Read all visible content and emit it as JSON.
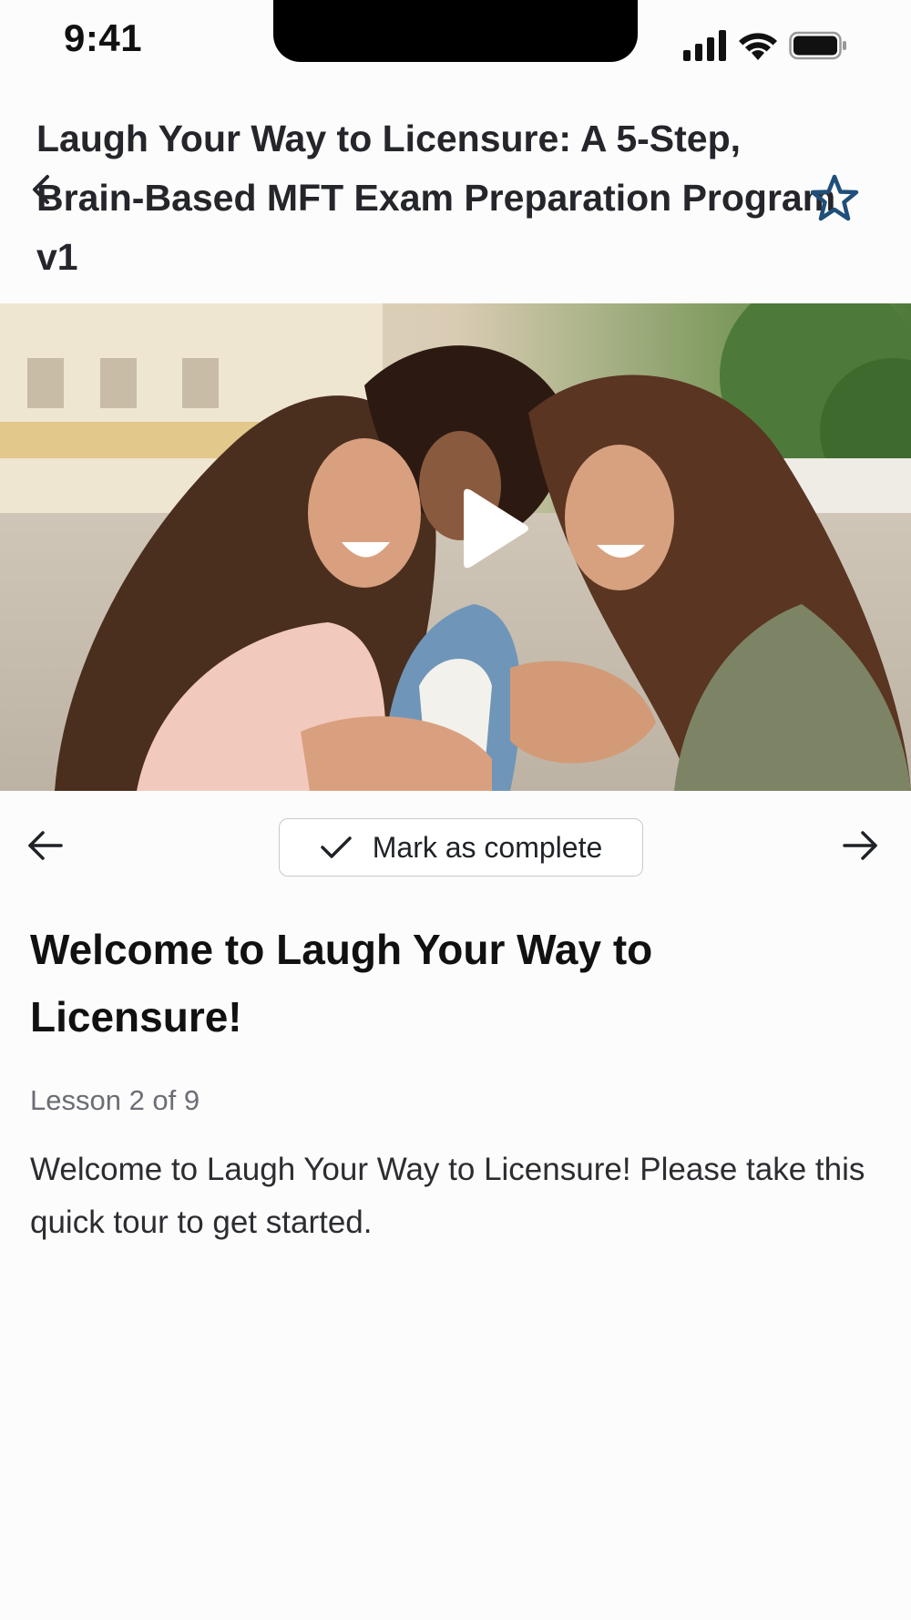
{
  "status_bar": {
    "time": "9:41",
    "icons": [
      "signal-icon",
      "wifi-icon",
      "battery-icon"
    ]
  },
  "header": {
    "course_title": "Laugh Your Way to Licensure: A 5-Step, Brain-Based MFT Exam Preparation Program v1",
    "back_icon": "chevron-left-icon",
    "favorite_icon": "star-outline-icon"
  },
  "video": {
    "play_icon": "play-icon"
  },
  "controls": {
    "prev_icon": "arrow-left-icon",
    "next_icon": "arrow-right-icon",
    "complete_label": "Mark as complete",
    "complete_icon": "check-icon"
  },
  "lesson": {
    "title": "Welcome to Laugh Your Way to Licensure!",
    "meta": "Lesson 2 of 9",
    "body": "Welcome to Laugh Your Way to Licensure! Please take this quick tour to get started."
  },
  "colors": {
    "accent": "#1f4f7a",
    "text": "#1f2328",
    "muted": "#6b6e75",
    "border": "#c9c9cc"
  }
}
